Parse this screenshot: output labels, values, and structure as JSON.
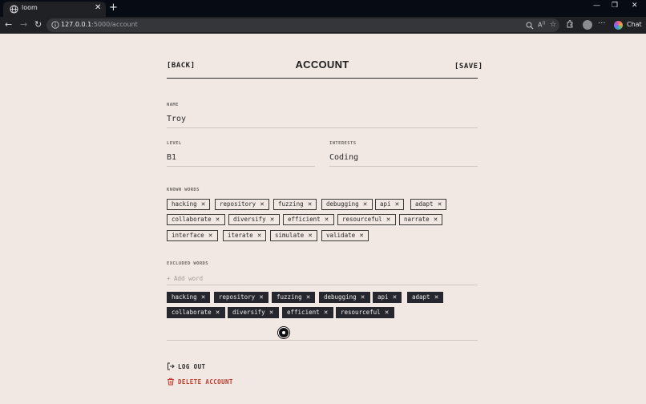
{
  "browser": {
    "tab_title": "loom",
    "tab_close": "✕",
    "new_tab": "+",
    "window_controls": {
      "minimize": "—",
      "restore": "❐",
      "close": "✕"
    },
    "nav": {
      "back": "←",
      "forward": "→",
      "reload": "↻"
    },
    "url_host": "127.0.0.1",
    "url_path": ":5000/account",
    "omnibox_icons": [
      "zoom-icon",
      "read-aloud-icon",
      "favorite-star-icon"
    ],
    "toolbar_icons": [
      "extensions-icon",
      "profile-avatar-icon",
      "more-menu-icon"
    ],
    "more_label": "···",
    "chat_label": "Chat"
  },
  "header": {
    "back_label": "[BACK]",
    "title": "ACCOUNT",
    "save_label": "[SAVE]"
  },
  "form": {
    "name_label": "NAME",
    "name_value": "Troy",
    "level_label": "LEVEL",
    "level_value": "B1",
    "interests_label": "INTERESTS",
    "interests_value": "Coding"
  },
  "known_words": {
    "label": "KNOWN WORDS",
    "items": [
      "hacking",
      "repository",
      "fuzzing",
      "debugging",
      "api",
      "adapt",
      "collaborate",
      "diversify",
      "efficient",
      "resourceful",
      "narrate",
      "interface",
      "iterate",
      "simulate",
      "validate"
    ],
    "remove_glyph": "✕"
  },
  "excluded_words": {
    "label": "EXCLUDED WORDS",
    "placeholder": "+ Add word",
    "items": [
      "hacking",
      "repository",
      "fuzzing",
      "debugging",
      "api",
      "adapt",
      "collaborate",
      "diversify",
      "efficient",
      "resourceful"
    ],
    "remove_glyph": "✕"
  },
  "actions": {
    "logout_label": "LOG OUT",
    "delete_label": "DELETE ACCOUNT",
    "logout_color": "#2a2a2a",
    "delete_color": "#c0392b"
  },
  "colors": {
    "page_bg": "#f1e7e3",
    "chip_dark_bg": "#25262e",
    "text": "#2a2a2a"
  }
}
